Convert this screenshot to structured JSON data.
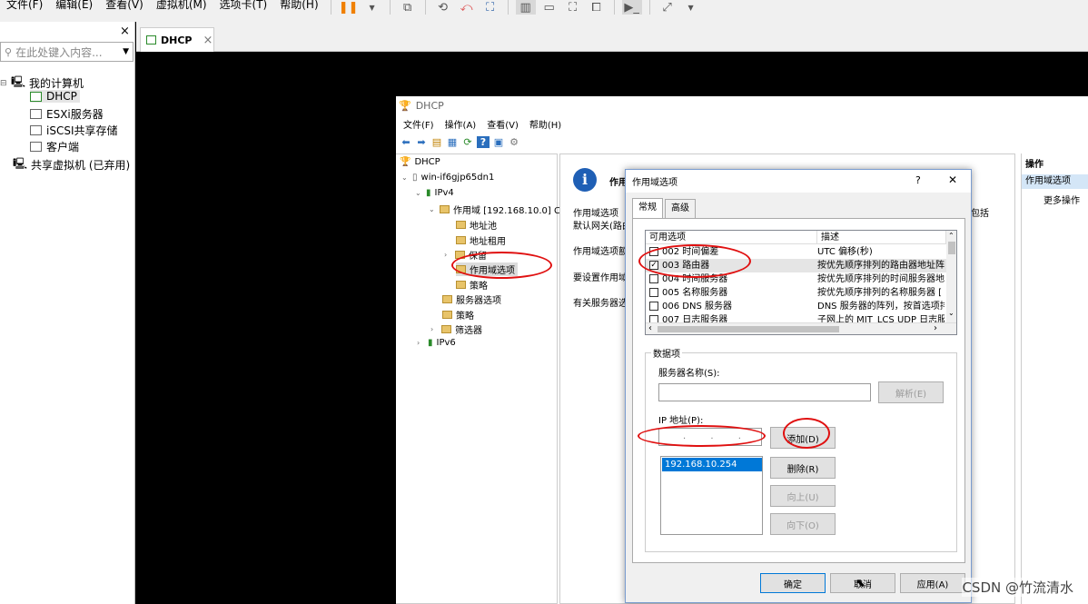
{
  "menubar": {
    "items": [
      "文件(F)",
      "编辑(E)",
      "查看(V)",
      "虚拟机(M)",
      "选项卡(T)",
      "帮助(H)"
    ]
  },
  "library": {
    "close": "×",
    "search_placeholder": "在此处键入内容...",
    "root": "我的计算机",
    "items": [
      "DHCP",
      "ESXi服务器",
      "iSCSI共享存储",
      "客户端"
    ],
    "shared": "共享虚拟机 (已弃用)"
  },
  "tab": {
    "label": "DHCP",
    "close": "×"
  },
  "mmc": {
    "title": "DHCP",
    "menu": [
      "文件(F)",
      "操作(A)",
      "查看(V)",
      "帮助(H)"
    ],
    "tree": {
      "root": "DHCP",
      "server": "win-if6gjp65dn1",
      "ipv4": "IPv4",
      "scope": "作用域 [192.168.10.0] C",
      "pool": "地址池",
      "leases": "地址租用",
      "reserve": "保留",
      "scope_opts": "作用域选项",
      "policy": "策略",
      "server_opts": "服务器选项",
      "policies": "策略",
      "filters": "筛选器",
      "ipv6": "IPv6"
    },
    "content": {
      "heading": "作用",
      "p1a": "作用域选项",
      "p1b": "默认网关(路由",
      "p1tail": "包括",
      "p2": "作用域选项额",
      "p3": "要设置作用域",
      "p4": "有关服务器选"
    },
    "actions": {
      "header": "操作",
      "selected": "作用域选项",
      "more": "更多操作"
    }
  },
  "dialog": {
    "title": "作用域选项",
    "help": "?",
    "close": "✕",
    "tabs": [
      "常规",
      "高级"
    ],
    "list": {
      "col1": "可用选项",
      "col2": "描述",
      "rows": [
        {
          "label": "002 时间偏差",
          "desc": "UTC 偏移(秒)",
          "checked": false
        },
        {
          "label": "003 路由器",
          "desc": "按优先顺序排列的路由器地址阵",
          "checked": true
        },
        {
          "label": "004 时间服务器",
          "desc": "按优先顺序排列的时间服务器地",
          "checked": false
        },
        {
          "label": "005 名称服务器",
          "desc": "按优先顺序排列的名称服务器 [",
          "checked": false
        },
        {
          "label": "006 DNS 服务器",
          "desc": "DNS 服务器的阵列，按首选项排",
          "checked": false
        },
        {
          "label": "007 日志服务器",
          "desc": "子网上的 MIT_LCS UDP 日志服",
          "checked": false
        }
      ]
    },
    "data_group": "数据项",
    "server_name_label": "服务器名称(S):",
    "resolve": "解析(E)",
    "ip_label": "IP 地址(P):",
    "ip_dots": ". . .",
    "add": "添加(D)",
    "remove": "删除(R)",
    "up": "向上(U)",
    "down": "向下(O)",
    "ip_entries": [
      "192.168.10.254"
    ],
    "ok": "确定",
    "cancel": "取消",
    "apply": "应用(A)"
  },
  "watermark": "CSDN @竹流清水"
}
